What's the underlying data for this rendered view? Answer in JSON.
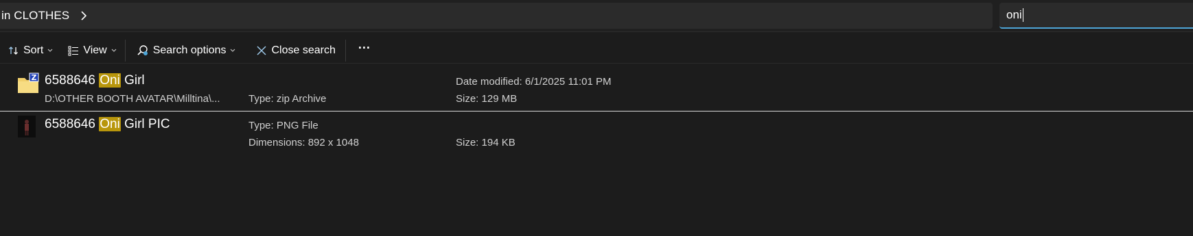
{
  "breadcrumb": {
    "current": "in CLOTHES"
  },
  "search": {
    "query": "oni"
  },
  "toolbar": {
    "sort_label": "Sort",
    "view_label": "View",
    "search_options_label": "Search options",
    "close_search_label": "Close search",
    "more_label": "···"
  },
  "results": [
    {
      "name_prefix": "6588646 ",
      "name_match": "Oni",
      "name_suffix": " Girl",
      "icon": "zip-folder-icon",
      "path": "D:\\OTHER BOOTH AVATAR\\Milltina\\...",
      "col2_line1": "",
      "col2_line2": "Type: zip Archive",
      "col3_line1": "Date modified: 6/1/2025 11:01 PM",
      "col3_line2": "Size: 129 MB"
    },
    {
      "name_prefix": "6588646 ",
      "name_match": "Oni",
      "name_suffix": " Girl PIC",
      "icon": "image-thumbnail-icon",
      "path": "",
      "col2_line1": "Type: PNG File",
      "col2_line2": "Dimensions: 892 x 1048",
      "col3_line1": "",
      "col3_line2": "Size: 194 KB"
    }
  ],
  "colors": {
    "background": "#1c1c1c",
    "accent": "#4ea6d8",
    "highlight": "#b8960c"
  }
}
